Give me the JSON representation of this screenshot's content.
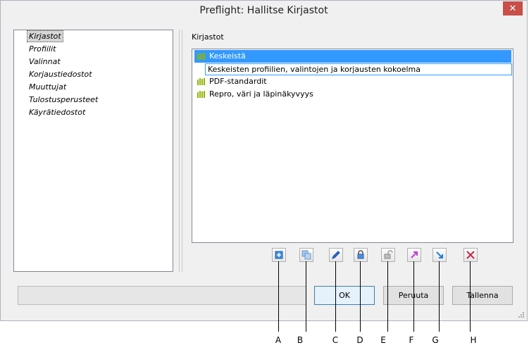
{
  "window": {
    "title": "Preflight: Hallitse Kirjastot",
    "close_icon": "close-icon"
  },
  "left_panel": {
    "items": [
      "Kirjastot",
      "Profiilit",
      "Valinnat",
      "Korjaustiedostot",
      "Muuttujat",
      "Tulostusperusteet",
      "Käyrätiedostot"
    ],
    "selected_index": 0
  },
  "right_panel": {
    "label": "Kirjastot",
    "libraries": [
      "Keskeistä",
      "PDF-standardit",
      "Repro, väri ja läpinäkyvyys"
    ],
    "selected_index": 0,
    "tooltip": "Keskeisten profiilien, valintojen ja korjausten kokoelma",
    "library_icon": "library-icon",
    "icon_color": "#8db600"
  },
  "toolbar": {
    "buttons": [
      {
        "icon": "new-icon"
      },
      {
        "icon": "duplicate-icon"
      },
      {
        "icon": "edit-icon"
      },
      {
        "icon": "lock-icon"
      },
      {
        "icon": "unlock-icon"
      },
      {
        "icon": "export-icon"
      },
      {
        "icon": "import-icon"
      },
      {
        "icon": "delete-icon"
      }
    ]
  },
  "buttons": {
    "ok": "OK",
    "cancel": "Peruuta",
    "save": "Tallenna"
  },
  "callouts": [
    "A",
    "B",
    "C",
    "D",
    "E",
    "F",
    "G",
    "H"
  ],
  "colors": {
    "selection": "#3399ff",
    "close": "#c74f47"
  }
}
